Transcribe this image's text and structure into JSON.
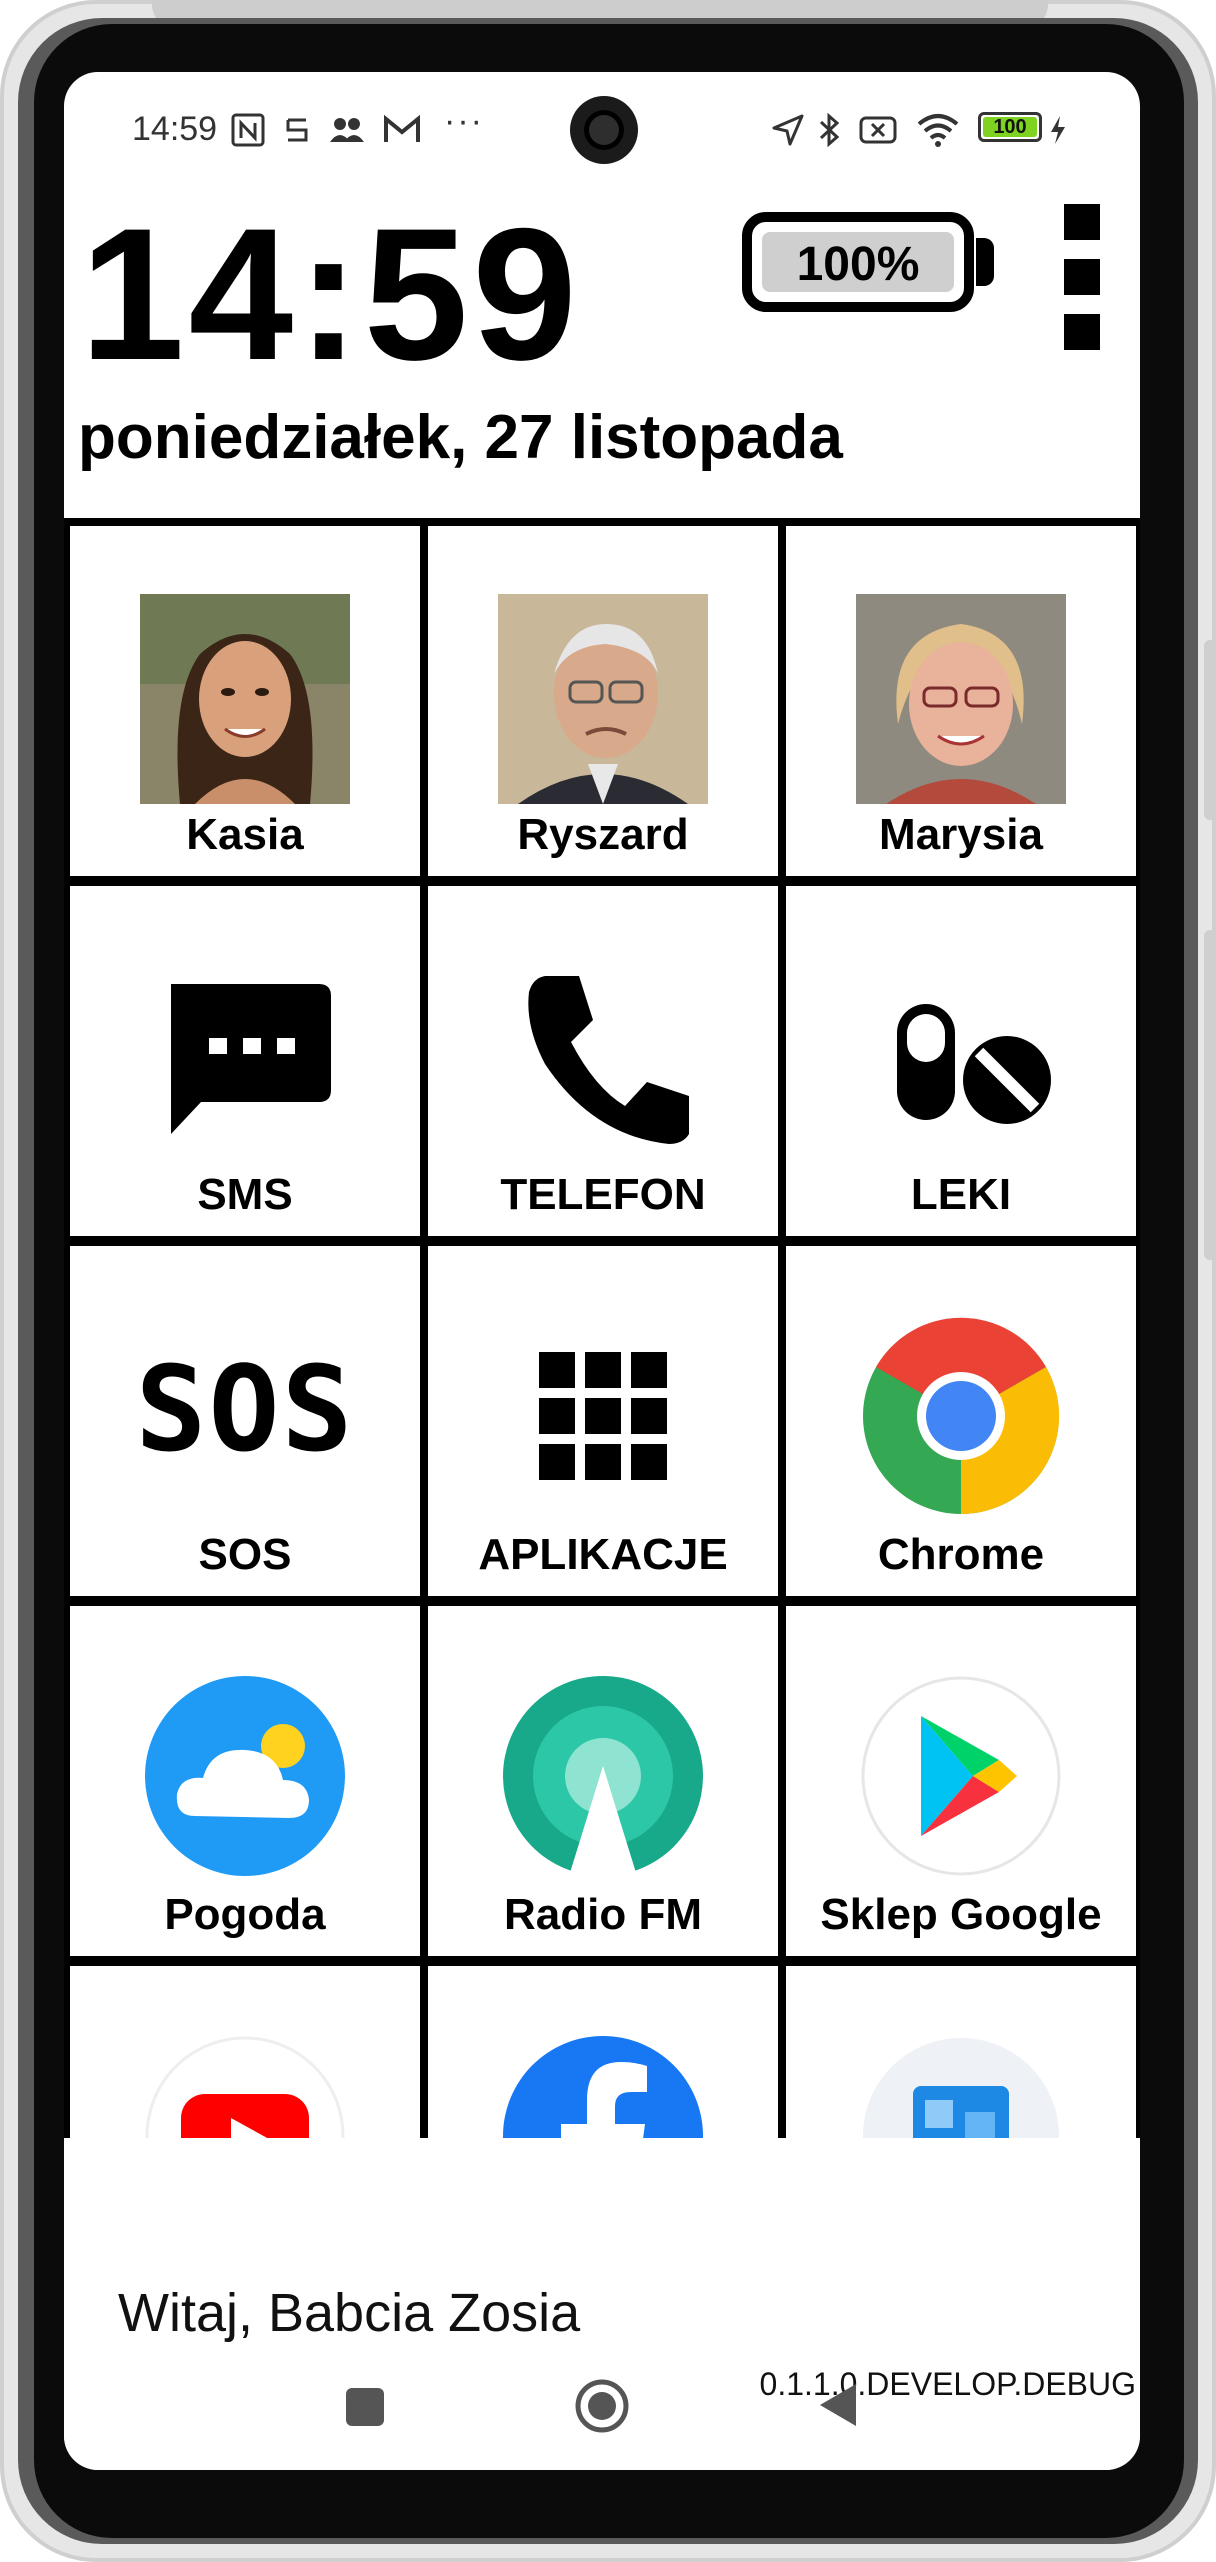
{
  "status_bar": {
    "time": "14:59",
    "battery_level": "100",
    "left_icons": [
      "nfc-icon",
      "sim-icon",
      "contacts-icon",
      "gmail-icon",
      "more-dots-icon"
    ],
    "right_icons": [
      "location-icon",
      "bluetooth-icon",
      "mute-icon",
      "wifi-icon",
      "battery-icon",
      "charging-icon"
    ]
  },
  "header": {
    "clock": "14:59",
    "date": "poniedziałek, 27 listopada",
    "battery_label": "100%",
    "battery_fraction": 1.0
  },
  "tiles": [
    {
      "label": "Kasia",
      "kind": "contact"
    },
    {
      "label": "Ryszard",
      "kind": "contact"
    },
    {
      "label": "Marysia",
      "kind": "contact"
    },
    {
      "label": "SMS",
      "icon": "sms-icon"
    },
    {
      "label": "TELEFON",
      "icon": "phone-icon"
    },
    {
      "label": "LEKI",
      "icon": "pills-icon"
    },
    {
      "label": "SOS",
      "icon": "sos-icon",
      "icon_text": "SOS"
    },
    {
      "label": "APLIKACJE",
      "icon": "apps-grid-icon"
    },
    {
      "label": "Chrome",
      "icon": "chrome-icon"
    },
    {
      "label": "Pogoda",
      "icon": "weather-icon"
    },
    {
      "label": "Radio FM",
      "icon": "radio-icon"
    },
    {
      "label": "Sklep Google",
      "icon": "play-store-icon"
    },
    {
      "label": "",
      "icon": "youtube-icon"
    },
    {
      "label": "",
      "icon": "facebook-icon"
    },
    {
      "label": "",
      "icon": "app-icon"
    }
  ],
  "footer": {
    "greeting": "Witaj, Babcia Zosia",
    "version": "0.1.1.0.DEVELOP.DEBUG"
  },
  "nav": [
    "recents-button",
    "home-button",
    "back-button"
  ],
  "colors": {
    "tile_border": "#000000",
    "chrome_red": "#EA4335",
    "chrome_green": "#34A853",
    "chrome_yellow": "#FBBC05",
    "chrome_blue": "#4285F4",
    "weather_blue": "#1F9BF5",
    "radio_teal": "#1DBE9E"
  }
}
